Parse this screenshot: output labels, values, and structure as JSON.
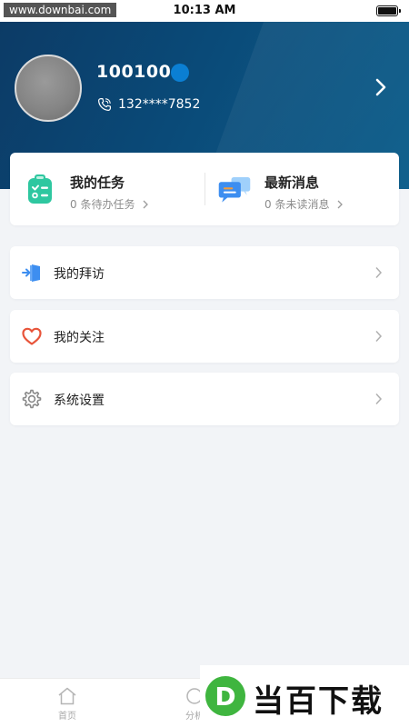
{
  "status_bar": {
    "time": "10:13 AM",
    "watermark": "www.downbai.com"
  },
  "profile": {
    "username": "100100",
    "phone": "132****7852"
  },
  "quick_actions": [
    {
      "title": "我的任务",
      "subtitle": "0 条待办任务"
    },
    {
      "title": "最新消息",
      "subtitle": "0 条未读消息"
    }
  ],
  "menu": [
    {
      "label": "我的拜访",
      "icon": "visit-door-icon"
    },
    {
      "label": "我的关注",
      "icon": "heart-icon"
    },
    {
      "label": "系统设置",
      "icon": "gear-icon"
    }
  ],
  "tabbar": [
    {
      "label": "首页",
      "icon": "home-icon"
    },
    {
      "label": "分析",
      "icon": "analysis-icon"
    }
  ],
  "brand": {
    "text": "当百下载",
    "logo": "D"
  },
  "colors": {
    "header_start": "#0c3b66",
    "header_end": "#0e5f8c",
    "badge": "#0b7fd3",
    "task_icon": "#2ec7a0",
    "message_icon": "#3d8ef0",
    "heart": "#e8543a"
  }
}
